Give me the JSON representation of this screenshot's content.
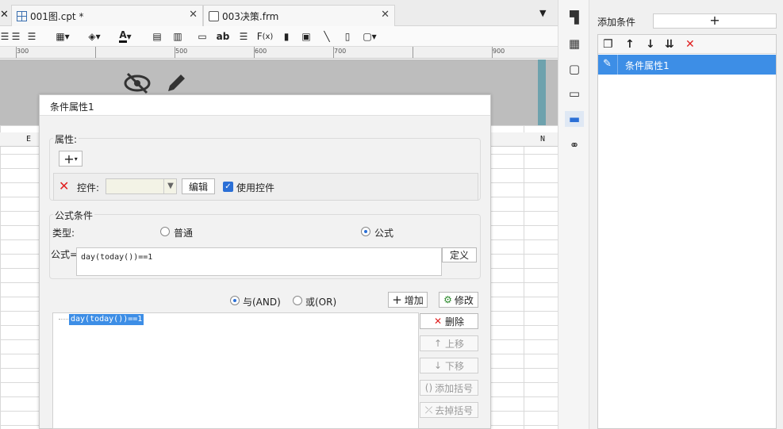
{
  "tabs": [
    {
      "label": "001图.cpt *",
      "icon": "grid-file-icon"
    },
    {
      "label": "003决策.frm",
      "icon": "form-file-icon"
    }
  ],
  "ruler": {
    "labels": [
      "300",
      "500",
      "600",
      "700",
      "900"
    ]
  },
  "right_panel": {
    "add_condition_label": "添加条件",
    "add_condition_button": "+",
    "conditions": [
      {
        "label": "条件属性1",
        "selected": true
      }
    ]
  },
  "dialog": {
    "title": "条件属性1",
    "attributes_section": "属性:",
    "add_attr_button": "+",
    "control_label": "控件:",
    "control_value": "",
    "edit_button": "编辑",
    "use_control_label": "使用控件",
    "use_control_checked": true,
    "formula_section": "公式条件",
    "type_label": "类型:",
    "type_options": [
      "普通",
      "公式"
    ],
    "type_selected": "公式",
    "formula_label": "公式=",
    "formula_value": "day(today())==1",
    "define_button": "定义",
    "logic_options": [
      "与(AND)",
      "或(OR)"
    ],
    "logic_selected": "与(AND)",
    "add_button": "增加",
    "modify_button": "修改",
    "delete_button": "删除",
    "move_up_button": "上移",
    "move_down_button": "下移",
    "add_bracket_button": "添加括号",
    "remove_bracket_button": "去掉括号",
    "condition_items": [
      "day(today())==1"
    ]
  },
  "sheet": {
    "column_headers": [
      "E",
      "N"
    ]
  },
  "colors": {
    "selection": "#3d8ee6",
    "delete_red": "#e02020",
    "checkbox": "#2b6fd6"
  }
}
